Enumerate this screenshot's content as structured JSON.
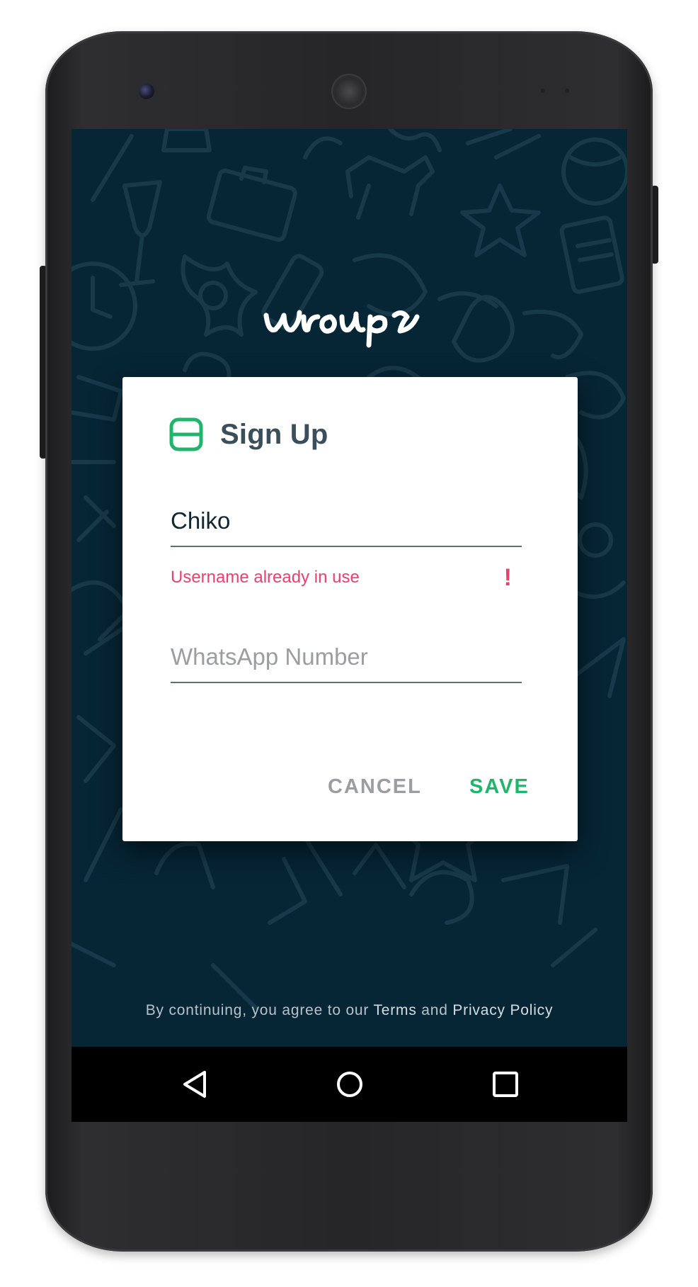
{
  "app": {
    "logo_text": "wroups"
  },
  "dialog": {
    "title": "Sign Up",
    "icon": "wroups-app-icon",
    "username_field": {
      "value": "Chiko",
      "error": "Username already in use",
      "error_icon": "!"
    },
    "whatsapp_field": {
      "value": "",
      "placeholder": "WhatsApp Number"
    },
    "cancel_label": "CANCEL",
    "save_label": "SAVE"
  },
  "legal": {
    "prefix": "By continuing, you agree to our ",
    "terms": "Terms",
    "and": " and ",
    "privacy": "Privacy Policy"
  },
  "nav": {
    "back": "back-icon",
    "home": "home-icon",
    "recents": "recents-icon"
  },
  "colors": {
    "background": "#062535",
    "accent": "#21b46c",
    "error": "#e8416f",
    "title": "#3b4f5a"
  }
}
